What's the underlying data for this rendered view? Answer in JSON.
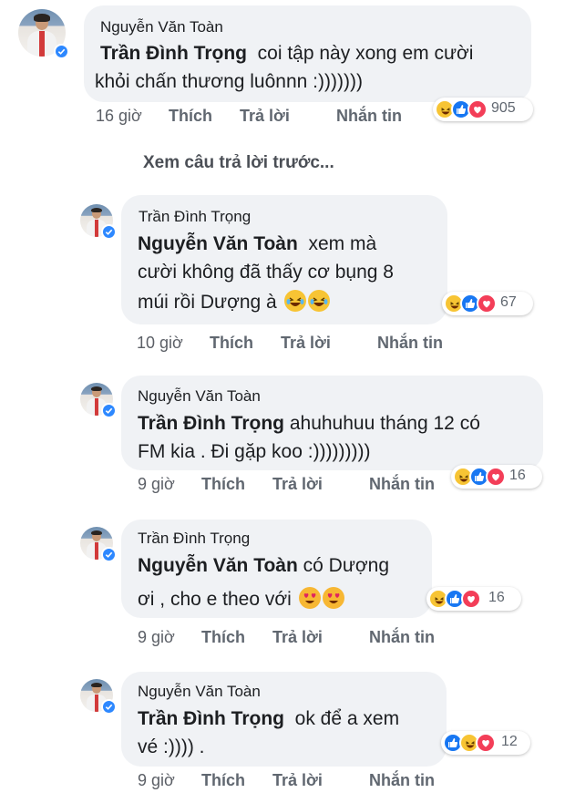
{
  "view_previous": "Xem câu trả lời trước...",
  "comments": [
    {
      "author": "Nguyễn Văn Toàn",
      "mention": "Trần Đình Trọng",
      "line1_rest": "coi tập này xong em cười",
      "line2": "khỏi chấn thương luônnn :)))))))",
      "time": "16 giờ",
      "like": "Thích",
      "reply": "Trả lời",
      "message": "Nhắn tin",
      "reaction_count": "905"
    },
    {
      "author": "Trần Đình Trọng",
      "mention": "Nguyễn Văn Toàn",
      "line1_rest": "xem mà",
      "line2": "cười không đã thấy cơ bụng 8",
      "line3": "múi rồi Dượng à",
      "time": "10 giờ",
      "like": "Thích",
      "reply": "Trả lời",
      "message": "Nhắn tin",
      "reaction_count": "67"
    },
    {
      "author": "Nguyễn Văn Toàn",
      "mention": "Trần Đình Trọng",
      "line1_rest": "ahuhuhuu tháng 12 có",
      "line2": "FM kia . Đi gặp koo :)))))))))",
      "time": "9 giờ",
      "like": "Thích",
      "reply": "Trả lời",
      "message": "Nhắn tin",
      "reaction_count": "16"
    },
    {
      "author": "Trần Đình Trọng",
      "mention": "Nguyễn Văn Toàn",
      "line1_rest": "có Dượng",
      "line2": "ơi , cho e theo với",
      "time": "9 giờ",
      "like": "Thích",
      "reply": "Trả lời",
      "message": "Nhắn tin",
      "reaction_count": "16"
    },
    {
      "author": "Nguyễn Văn Toàn",
      "mention": "Trần Đình Trọng",
      "line1_rest": "ok để a xem",
      "line2": "vé :)))) .",
      "time": "9 giờ",
      "like": "Thích",
      "reply": "Trả lời",
      "message": "Nhắn tin",
      "reaction_count": "12"
    }
  ],
  "colors": {
    "bubble": "#f0f2f5",
    "like_blue": "#1877f2",
    "love_red": "#f33e58",
    "haha_yellow": "#f7c434",
    "verified_blue": "#2d88ff"
  }
}
